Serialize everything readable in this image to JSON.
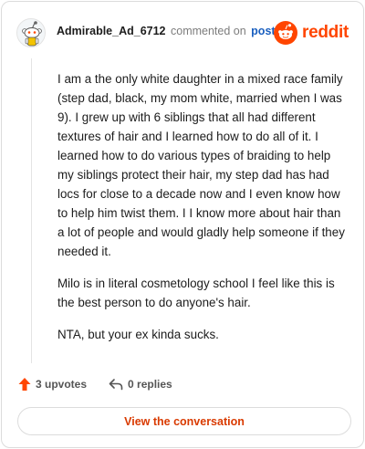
{
  "comment": {
    "username": "Admirable_Ad_6712",
    "commented_text": "commented on",
    "post_link": "post",
    "brand": "reddit",
    "paragraphs": [
      "I am a the only white daughter in a mixed race family (step dad, black, my mom white, married when I was 9). I grew up with 6 siblings that all had different textures of hair and I learned how to do all of it. I learned how to do various types of braiding to help my siblings protect their hair, my step dad has had locs for close to a decade now and I even know how to help him twist them. I I know more about hair than a lot of people and would gladly help someone if they needed it.",
      "Milo is in literal cosmetology school I feel like this is the best person to do anyone's hair.",
      "NTA, but your ex kinda sucks."
    ],
    "upvotes": "3 upvotes",
    "replies": "0 replies",
    "view_button": "View the conversation"
  },
  "colors": {
    "reddit_orange": "#ff4500",
    "link_blue": "#1a5fbf",
    "button_text": "#d93a00"
  },
  "icons": {
    "avatar": "snoo-avatar-icon",
    "brand": "reddit-logo-icon",
    "upvote": "upvote-arrow-icon",
    "reply": "reply-arrow-icon"
  }
}
